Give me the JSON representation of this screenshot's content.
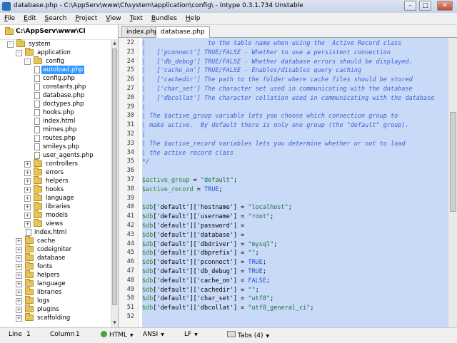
{
  "window": {
    "title": "database.php - C:\\AppServ\\www\\CI\\system\\application\\config\\ - Intype 0.3.1.734 Unstable",
    "minimize": "–",
    "maximize": "□",
    "close": "✕"
  },
  "menu": [
    "File",
    "Edit",
    "Search",
    "Project",
    "View",
    "Text",
    "Bundles",
    "Help"
  ],
  "sidebar": {
    "root": "C:\\AppServ\\www\\CI",
    "tree": [
      {
        "label": "system",
        "type": "folder",
        "level": 0,
        "expand": "-"
      },
      {
        "label": "application",
        "type": "folder",
        "level": 1,
        "expand": "-"
      },
      {
        "label": "config",
        "type": "folder",
        "level": 2,
        "expand": "-"
      },
      {
        "label": "autoload.php",
        "type": "file",
        "level": 3,
        "selected": true
      },
      {
        "label": "config.php",
        "type": "file",
        "level": 3
      },
      {
        "label": "constants.php",
        "type": "file",
        "level": 3
      },
      {
        "label": "database.php",
        "type": "file",
        "level": 3
      },
      {
        "label": "doctypes.php",
        "type": "file",
        "level": 3
      },
      {
        "label": "hooks.php",
        "type": "file",
        "level": 3
      },
      {
        "label": "index.html",
        "type": "file",
        "level": 3
      },
      {
        "label": "mimes.php",
        "type": "file",
        "level": 3
      },
      {
        "label": "routes.php",
        "type": "file",
        "level": 3
      },
      {
        "label": "smileys.php",
        "type": "file",
        "level": 3
      },
      {
        "label": "user_agents.php",
        "type": "file",
        "level": 3
      },
      {
        "label": "controllers",
        "type": "folder",
        "level": 2,
        "expand": "+"
      },
      {
        "label": "errors",
        "type": "folder",
        "level": 2,
        "expand": "+"
      },
      {
        "label": "helpers",
        "type": "folder",
        "level": 2,
        "expand": "+"
      },
      {
        "label": "hooks",
        "type": "folder",
        "level": 2,
        "expand": "+"
      },
      {
        "label": "language",
        "type": "folder",
        "level": 2,
        "expand": "+"
      },
      {
        "label": "libraries",
        "type": "folder",
        "level": 2,
        "expand": "+"
      },
      {
        "label": "models",
        "type": "folder",
        "level": 2,
        "expand": "+"
      },
      {
        "label": "views",
        "type": "folder",
        "level": 2,
        "expand": "+"
      },
      {
        "label": "index.html",
        "type": "file",
        "level": 2
      },
      {
        "label": "cache",
        "type": "folder",
        "level": 1,
        "expand": "+"
      },
      {
        "label": "codeigniter",
        "type": "folder",
        "level": 1,
        "expand": "+"
      },
      {
        "label": "database",
        "type": "folder",
        "level": 1,
        "expand": "+"
      },
      {
        "label": "fonts",
        "type": "folder",
        "level": 1,
        "expand": "+"
      },
      {
        "label": "helpers",
        "type": "folder",
        "level": 1,
        "expand": "+"
      },
      {
        "label": "language",
        "type": "folder",
        "level": 1,
        "expand": "+"
      },
      {
        "label": "libraries",
        "type": "folder",
        "level": 1,
        "expand": "+"
      },
      {
        "label": "logs",
        "type": "folder",
        "level": 1,
        "expand": "+"
      },
      {
        "label": "plugins",
        "type": "folder",
        "level": 1,
        "expand": "+"
      },
      {
        "label": "scaffolding",
        "type": "folder",
        "level": 1,
        "expand": "+"
      }
    ]
  },
  "tabs": [
    {
      "label": "index.php",
      "active": false
    },
    {
      "label": "database.php",
      "active": true
    }
  ],
  "editor": {
    "lines": [
      {
        "n": "22",
        "kind": "comment",
        "text": "|                 to the table name when using the  Active Record class"
      },
      {
        "n": "23",
        "kind": "comment",
        "text": "|   ['pconnect'] TRUE/FALSE - Whether to use a persistent connection"
      },
      {
        "n": "24",
        "kind": "comment",
        "text": "|   ['db_debug'] TRUE/FALSE - Whether database errors should be displayed."
      },
      {
        "n": "25",
        "kind": "comment",
        "text": "|   ['cache_on'] TRUE/FALSE - Enables/disables query caching"
      },
      {
        "n": "26",
        "kind": "comment",
        "text": "|   ['cachedir'] The path to the folder where cache files should be stored"
      },
      {
        "n": "27",
        "kind": "comment",
        "text": "|   ['char_set'] The character set used in communicating with the database"
      },
      {
        "n": "28",
        "kind": "comment",
        "text": "|   ['dbcollat'] The character collation used in communicating with the database"
      },
      {
        "n": "29",
        "kind": "comment",
        "text": "|"
      },
      {
        "n": "30",
        "kind": "comment",
        "text": "| The $active_group variable lets you choose which connection group to"
      },
      {
        "n": "31",
        "kind": "comment",
        "text": "| make active.  By default there is only one group (the \"default\" group)."
      },
      {
        "n": "32",
        "kind": "comment",
        "text": "|"
      },
      {
        "n": "33",
        "kind": "comment",
        "text": "| The $active_record variables lets you determine whether or not to load"
      },
      {
        "n": "34",
        "kind": "comment",
        "text": "| the active record class"
      },
      {
        "n": "35",
        "kind": "comment",
        "text": "*/"
      },
      {
        "n": "36",
        "kind": "blank",
        "text": ""
      },
      {
        "n": "37",
        "kind": "code",
        "parts": [
          [
            "var",
            "$active_group"
          ],
          [
            "pl",
            " = "
          ],
          [
            "str",
            "\"default\""
          ],
          [
            "pl",
            ";"
          ]
        ]
      },
      {
        "n": "38",
        "kind": "code",
        "parts": [
          [
            "var",
            "$active_record"
          ],
          [
            "pl",
            " = "
          ],
          [
            "kw",
            "TRUE"
          ],
          [
            "pl",
            ";"
          ]
        ]
      },
      {
        "n": "39",
        "kind": "blank",
        "text": ""
      },
      {
        "n": "40",
        "kind": "code",
        "parts": [
          [
            "var",
            "$db"
          ],
          [
            "pl",
            "['default']['hostname'] = "
          ],
          [
            "str",
            "\"localhost\""
          ],
          [
            "pl",
            ";"
          ]
        ]
      },
      {
        "n": "41",
        "kind": "code",
        "parts": [
          [
            "var",
            "$db"
          ],
          [
            "pl",
            "['default']['username'] = "
          ],
          [
            "str",
            "\"root\""
          ],
          [
            "pl",
            ";"
          ]
        ]
      },
      {
        "n": "42",
        "kind": "code",
        "parts": [
          [
            "var",
            "$db"
          ],
          [
            "pl",
            "['default']['password'] ="
          ]
        ]
      },
      {
        "n": "43",
        "kind": "code",
        "parts": [
          [
            "var",
            "$db"
          ],
          [
            "pl",
            "['default']['database'] ="
          ]
        ]
      },
      {
        "n": "44",
        "kind": "code",
        "parts": [
          [
            "var",
            "$db"
          ],
          [
            "pl",
            "['default']['dbdriver'] = "
          ],
          [
            "str",
            "\"mysql\""
          ],
          [
            "pl",
            ";"
          ]
        ]
      },
      {
        "n": "45",
        "kind": "code",
        "parts": [
          [
            "var",
            "$db"
          ],
          [
            "pl",
            "['default']['dbprefix'] = "
          ],
          [
            "str",
            "\"\""
          ],
          [
            "pl",
            ";"
          ]
        ]
      },
      {
        "n": "46",
        "kind": "code",
        "parts": [
          [
            "var",
            "$db"
          ],
          [
            "pl",
            "['default']['pconnect'] = "
          ],
          [
            "kw",
            "TRUE"
          ],
          [
            "pl",
            ";"
          ]
        ]
      },
      {
        "n": "47",
        "kind": "code",
        "parts": [
          [
            "var",
            "$db"
          ],
          [
            "pl",
            "['default']['db_debug'] = "
          ],
          [
            "kw",
            "TRUE"
          ],
          [
            "pl",
            ";"
          ]
        ]
      },
      {
        "n": "48",
        "kind": "code",
        "parts": [
          [
            "var",
            "$db"
          ],
          [
            "pl",
            "['default']['cache_on'] = "
          ],
          [
            "kw",
            "FALSE"
          ],
          [
            "pl",
            ";"
          ]
        ]
      },
      {
        "n": "49",
        "kind": "code",
        "parts": [
          [
            "var",
            "$db"
          ],
          [
            "pl",
            "['default']['cachedir'] = "
          ],
          [
            "str",
            "\"\""
          ],
          [
            "pl",
            ";"
          ]
        ]
      },
      {
        "n": "50",
        "kind": "code",
        "parts": [
          [
            "var",
            "$db"
          ],
          [
            "pl",
            "['default']['char_set'] = "
          ],
          [
            "str",
            "\"utf8\""
          ],
          [
            "pl",
            ";"
          ]
        ]
      },
      {
        "n": "51",
        "kind": "code",
        "parts": [
          [
            "var",
            "$db"
          ],
          [
            "pl",
            "['default']['dbcollat'] = "
          ],
          [
            "str",
            "\"utf8_general_ci\""
          ],
          [
            "pl",
            ";"
          ]
        ]
      },
      {
        "n": "52",
        "kind": "blank",
        "text": ""
      }
    ]
  },
  "status": {
    "line_label": "Line",
    "line_value": "1",
    "column_label": "Column",
    "column_value": "1",
    "language": "HTML",
    "encoding": "ANSI",
    "line_ending": "LF",
    "tabs": "Tabs (4)"
  }
}
